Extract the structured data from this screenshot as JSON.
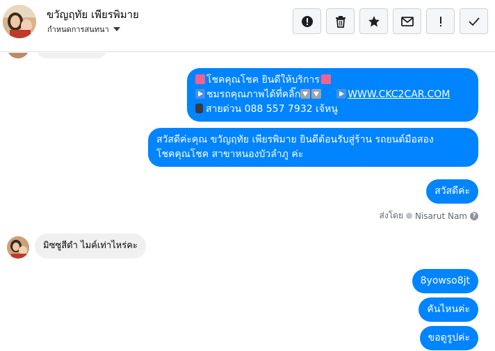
{
  "header": {
    "contact_name": "ขวัญฤทัย เพียรพิมาย",
    "status_label": "กำหนดการสนทนา",
    "icons": [
      "alert-circle-icon",
      "trash-icon",
      "star-icon",
      "envelope-icon",
      "exclamation-icon",
      "checkmark-icon"
    ]
  },
  "messages": {
    "promo": {
      "line1": "โชคคุณโชค ยินดีให้บริการ",
      "line2_text": "ชมรถคุณภาพได้ที่คลิ๊ก",
      "line2_link": "WWW.CKC2CAR.COM",
      "line3": "สายด่วน 088 557 7932 เจ้หนู"
    },
    "welcome": {
      "line1": "สวัสดีค่ะคุณ ขวัญฤทัย เพียรพิมาย ยินดีต้อนรับสู่ร้าน รถยนต์มือสอง",
      "line2": "โชคคุณโชค สาขาหนองบัวลำภู ค่ะ"
    },
    "greeting": "สวัสดีค่ะ",
    "sent_by_label": "ส่งโดย",
    "sent_by_name": "Nisarut Nam",
    "incoming_1": "มิซซูสีดำ ไมค์เท่าไหร่คะ",
    "outgoing_code": "8yowso8jt",
    "outgoing_which": "คันไหนค่ะ",
    "outgoing_photo": "ขอดูรูปค่ะ"
  },
  "colors": {
    "outgoing_bubble": "#0084ff",
    "incoming_bubble": "#f0f0f0",
    "toolbar_button_bg": "#f5f6f7"
  }
}
